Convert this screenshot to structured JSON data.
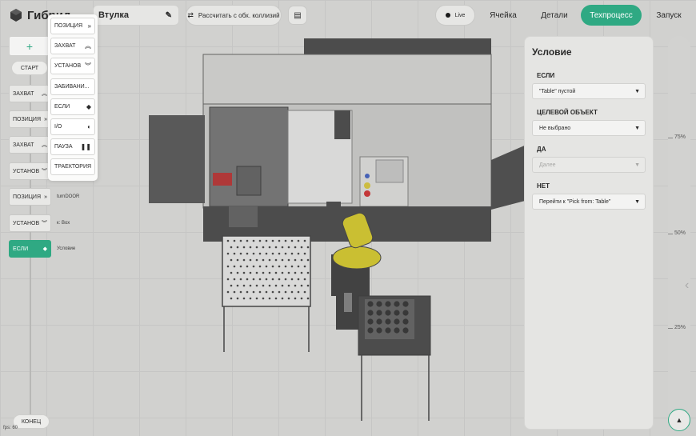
{
  "app": {
    "name": "Гибрид"
  },
  "header": {
    "part_name": "Втулка",
    "collision_button": "Рассчитать с обх. коллизий",
    "live_label": "Live",
    "tabs": [
      "Ячейка",
      "Детали",
      "Техпроцесс",
      "Запуск"
    ],
    "active_tab": "Техпроцесс"
  },
  "program": {
    "start_label": "СТАРТ",
    "end_label": "КОНЕЦ",
    "steps": [
      {
        "label": "ЗАХВАТ",
        "icon": "chevron-double-up-icon",
        "note": ""
      },
      {
        "label": "ПОЗИЦИЯ",
        "icon": "chevron-double-right-icon",
        "note": ""
      },
      {
        "label": "ЗАХВАТ",
        "icon": "chevron-double-up-icon",
        "note": ""
      },
      {
        "label": "УСТАНОВ",
        "icon": "chevron-double-down-icon",
        "note": ""
      },
      {
        "label": "ПОЗИЦИЯ",
        "icon": "chevron-double-right-icon",
        "note": "turnDOOR"
      },
      {
        "label": "УСТАНОВ",
        "icon": "chevron-double-down-icon",
        "note": "к: Box"
      },
      {
        "label": "ЕСЛИ",
        "icon": "diamond-icon",
        "note": "Условие"
      }
    ],
    "active_step": 6
  },
  "palette": {
    "items": [
      {
        "label": "ПОЗИЦИЯ",
        "icon": "chevron-double-right-icon"
      },
      {
        "label": "ЗАХВАТ",
        "icon": "chevron-double-up-icon"
      },
      {
        "label": "УСТАНОВ",
        "icon": "chevron-double-down-icon"
      },
      {
        "label": "ЗАБИВАНИ...",
        "icon": ""
      },
      {
        "label": "ЕСЛИ",
        "icon": "diamond-icon"
      },
      {
        "label": "I/O",
        "icon": "half-circle-icon"
      },
      {
        "label": "ПАУЗА",
        "icon": "pause-icon"
      },
      {
        "label": "ТРАЕКТОРИЯ",
        "icon": ""
      }
    ]
  },
  "condition": {
    "title": "Условие",
    "if_label": "ЕСЛИ",
    "if_value": "\"Table\" пустой",
    "target_label": "ЦЕЛЕВОЙ ОБЪЕКТ",
    "target_value": "Не выбрано",
    "yes_label": "ДА",
    "yes_value": "Далее",
    "no_label": "НЕТ",
    "no_value": "Перейти к \"Pick from: Table\""
  },
  "ruler": {
    "ticks": [
      "75%",
      "50%",
      "25%"
    ]
  },
  "status": {
    "fps": "fps: 60"
  },
  "colors": {
    "accent": "#2fa983",
    "robot": "#d4c61a"
  }
}
